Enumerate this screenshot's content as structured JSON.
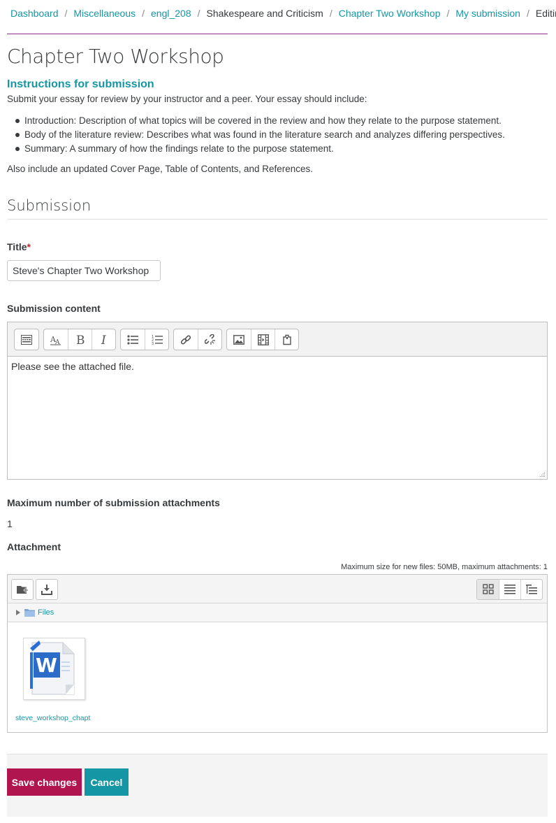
{
  "breadcrumb": [
    {
      "label": "Dashboard",
      "link": true
    },
    {
      "label": "Miscellaneous",
      "link": true
    },
    {
      "label": "engl_208",
      "link": true
    },
    {
      "label": "Shakespeare and Criticism",
      "link": false
    },
    {
      "label": "Chapter Two Workshop",
      "link": true
    },
    {
      "label": "My submission",
      "link": true
    },
    {
      "label": "Editing",
      "link": false
    }
  ],
  "page": {
    "title": "Chapter Two Workshop"
  },
  "instructions": {
    "heading": "Instructions for submission",
    "intro": "Submit your essay for review by your instructor and a peer. Your essay should include:",
    "items": [
      "Introduction: Description of what topics will be covered in the review and how they relate to the purpose statement.",
      "Body of the literature review: Describes what was found in the literature search and analyzes differing perspectives.",
      "Summary: A summary of how the findings relate to the purpose statement."
    ],
    "also": "Also include an updated Cover Page, Table of Contents, and References."
  },
  "submission": {
    "heading": "Submission",
    "title_label": "Title",
    "required_mark": "*",
    "title_value": "Steve's Chapter Two Workshop",
    "content_label": "Submission content",
    "content_text": "Please see the attached file.",
    "max_attachments_label": "Maximum number of submission attachments",
    "max_attachments_value": "1",
    "attachment_label": "Attachment"
  },
  "toolbar_icons": [
    "toolbar-toggle-icon",
    "font-style-icon",
    "bold-icon",
    "italic-icon",
    "unordered-list-icon",
    "ordered-list-icon",
    "link-icon",
    "unlink-icon",
    "image-icon",
    "media-icon",
    "file-manager-icon"
  ],
  "filepicker": {
    "info": "Maximum size for new files: 50MB, maximum attachments: 1",
    "path_root": "Files",
    "file_name": "steve_workshop_chapt",
    "file_name_cut": "...",
    "views": [
      "icon-view-icon",
      "list-view-icon",
      "tree-view-icon"
    ]
  },
  "actions": {
    "save": "Save changes",
    "cancel": "Cancel"
  },
  "colors": {
    "accent": "#1596a4",
    "save": "#b0154f",
    "divider": "#8a2e8a",
    "required": "#c12a2a"
  }
}
